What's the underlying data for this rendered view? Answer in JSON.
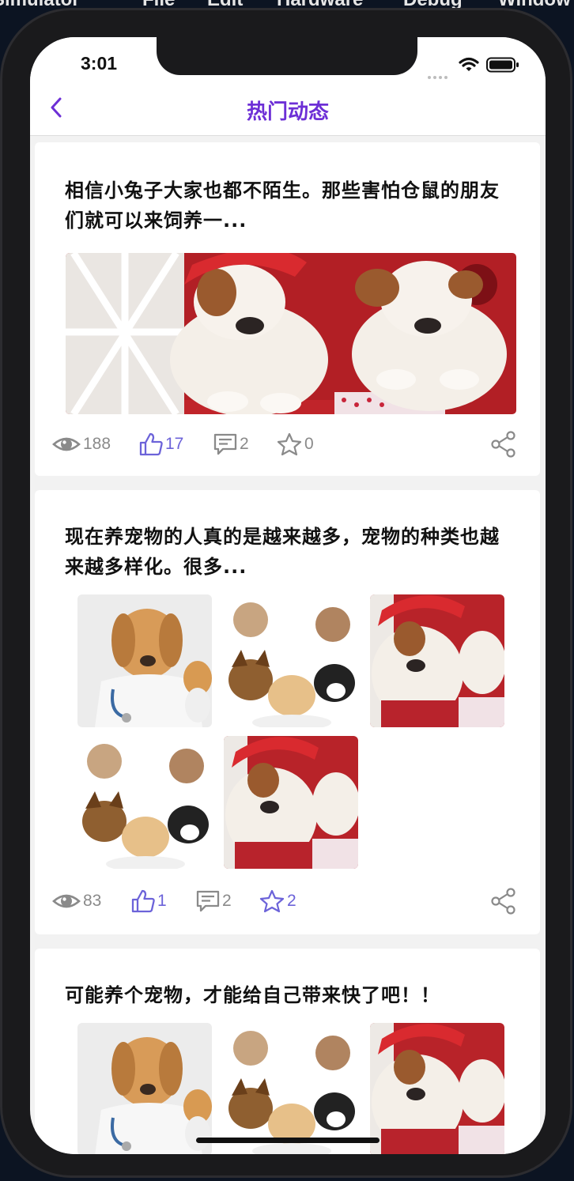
{
  "desktop_menu": [
    "Simulator",
    "File",
    "Edit",
    "Hardware",
    "Debug",
    "Window"
  ],
  "status_bar": {
    "time": "3:01"
  },
  "nav": {
    "title": "热门动态"
  },
  "posts": [
    {
      "text": "相信小兔子大家也都不陌生。那些害怕仓鼠的朋友们就可以来饲养一...",
      "views": "188",
      "likes": "17",
      "comments": "2",
      "favorites": "0",
      "liked": true,
      "favorited": false
    },
    {
      "text": "现在养宠物的人真的是越来越多，宠物的种类也越来越多样化。很多...",
      "views": "83",
      "likes": "1",
      "comments": "2",
      "favorites": "2",
      "liked": true,
      "favorited": true
    },
    {
      "text": "可能养个宠物，才能给自己带来快了吧！！"
    }
  ],
  "colors": {
    "accent": "#6c63d9",
    "title": "#6d2fd6",
    "muted": "#8a8a8a"
  },
  "icons": [
    "back-chevron-icon",
    "wifi-icon",
    "battery-icon",
    "eye-icon",
    "thumbs-up-icon",
    "comment-icon",
    "star-icon",
    "share-icon"
  ]
}
